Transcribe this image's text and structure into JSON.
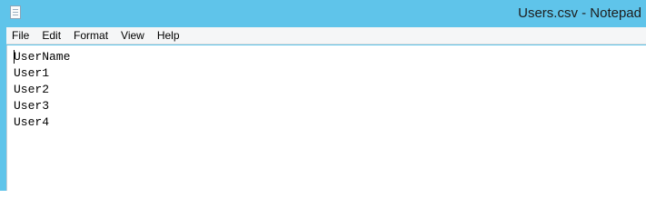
{
  "window": {
    "title": "Users.csv - Notepad",
    "icon": "notepad-icon"
  },
  "menu": {
    "items": [
      "File",
      "Edit",
      "Format",
      "View",
      "Help"
    ]
  },
  "editor": {
    "lines": [
      "UserName",
      "User1",
      "User2",
      "User3",
      "User4"
    ]
  },
  "colors": {
    "titlebar": "#5fc4ea",
    "menubar": "#f5f6f7",
    "editor_background": "#ffffff"
  }
}
